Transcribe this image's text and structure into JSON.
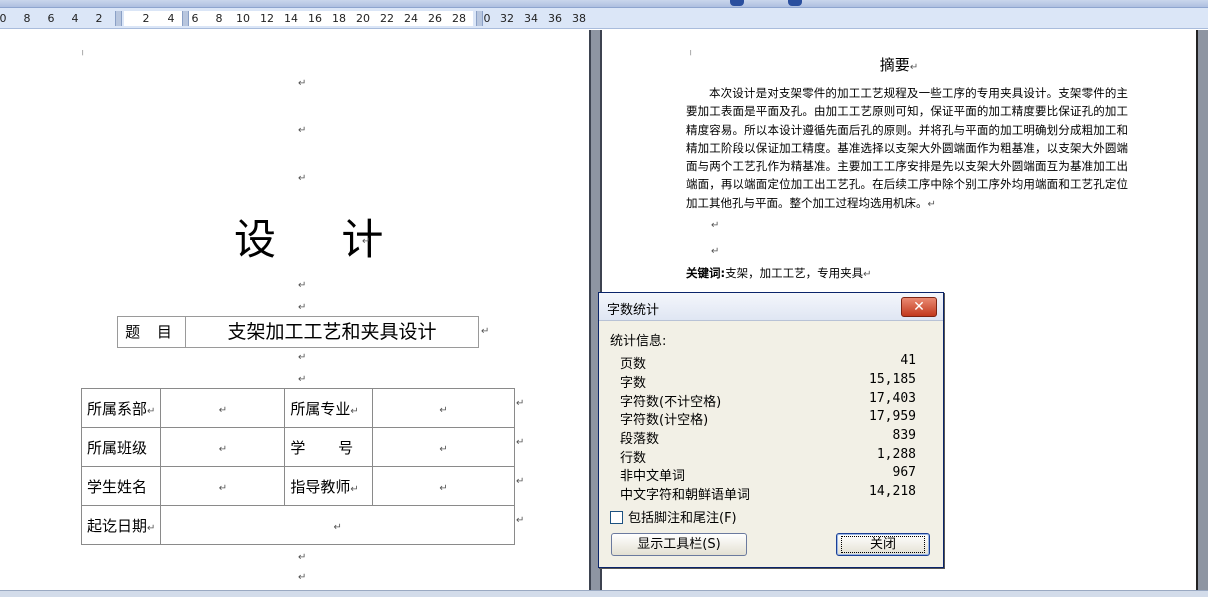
{
  "ruler": {
    "ticks": [
      "0",
      "8",
      "6",
      "4",
      "2",
      "2",
      "4",
      "6",
      "8",
      "10",
      "12",
      "14",
      "16",
      "18",
      "20",
      "22",
      "24",
      "26",
      "28",
      "0",
      "32",
      "34",
      "36",
      "38"
    ]
  },
  "marks": {
    "para": "↵",
    "corner": "╷"
  },
  "cover": {
    "title": "设 计",
    "topic_label": "题 目",
    "topic_value": "支架加工工艺和夹具设计",
    "rows": [
      {
        "label1": "所属系部",
        "label2": "所属专业"
      },
      {
        "label1": "所属班级",
        "label2": "学 号"
      },
      {
        "label1": "学生姓名",
        "label2": "指导教师"
      }
    ],
    "date_label": "起讫日期"
  },
  "abstract": {
    "title": "摘要",
    "body": "本次设计是对支架零件的加工工艺规程及一些工序的专用夹具设计。支架零件的主要加工表面是平面及孔。由加工工艺原则可知，保证平面的加工精度要比保证孔的加工精度容易。所以本设计遵循先面后孔的原则。并将孔与平面的加工明确划分成粗加工和精加工阶段以保证加工精度。基准选择以支架大外圆端面作为粗基准，以支架大外圆端面与两个工艺孔作为精基准。主要加工工序安排是先以支架大外圆端面互为基准加工出端面，再以端面定位加工出工艺孔。在后续工序中除个别工序外均用端面和工艺孔定位加工其他孔与平面。整个加工过程均选用机床。",
    "keywords_label": "关键词:",
    "keywords_value": "支架，加工工艺，专用夹具"
  },
  "dialog": {
    "title": "字数统计",
    "close_glyph": "✕",
    "section": "统计信息:",
    "stats": [
      {
        "label": "页数",
        "value": "41"
      },
      {
        "label": "字数",
        "value": "15,185"
      },
      {
        "label": "字符数(不计空格)",
        "value": "17,403"
      },
      {
        "label": "字符数(计空格)",
        "value": "17,959"
      },
      {
        "label": "段落数",
        "value": "839"
      },
      {
        "label": "行数",
        "value": "1,288"
      },
      {
        "label": "非中文单词",
        "value": "967"
      },
      {
        "label": "中文字符和朝鲜语单词",
        "value": "14,218"
      }
    ],
    "checkbox_label": "包括脚注和尾注(F)",
    "toolbar_button": "显示工具栏(S)",
    "close_button": "关闭"
  }
}
